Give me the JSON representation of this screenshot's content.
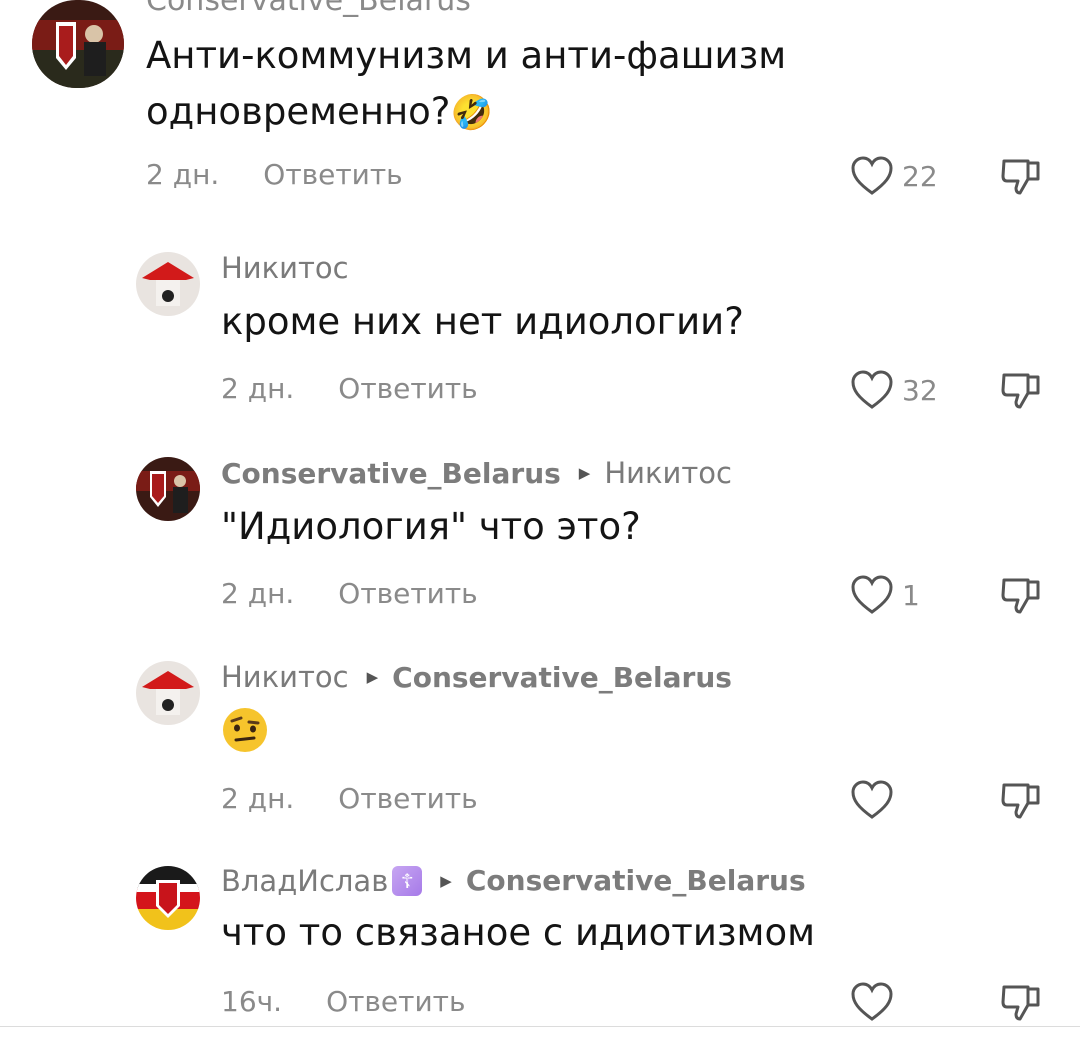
{
  "comments": [
    {
      "author": "Conservative_Belarus",
      "text_line1": "Анти-коммунизм и анти-фашизм",
      "text_line2": "одновременно?",
      "emoji": "🤣",
      "time": "2 дн.",
      "reply_label": "Ответить",
      "likes": "22"
    },
    {
      "author": "Никитос",
      "text": "кроме них нет идиологии?",
      "time": "2 дн.",
      "reply_label": "Ответить",
      "likes": "32"
    },
    {
      "author": "Conservative_Belarus",
      "reply_to": "Никитос",
      "text": "\"Идиология\" что это?",
      "time": "2 дн.",
      "reply_label": "Ответить",
      "likes": "1"
    },
    {
      "author": "Никитос",
      "reply_to": "Conservative_Belarus",
      "emoji": "🤨",
      "time": "2 дн.",
      "reply_label": "Ответить",
      "likes": ""
    },
    {
      "author": "ВладИслав",
      "author_badge": "☦",
      "reply_to": "Conservative_Belarus",
      "text": "что то связаное с идиотизмом",
      "time": "16ч.",
      "reply_label": "Ответить",
      "likes": ""
    }
  ],
  "icons": {
    "like": "heart-outline-icon",
    "dislike": "thumbs-down-icon",
    "reply_arrow": "triangle-right-icon"
  },
  "colors": {
    "text": "#141414",
    "secondary": "#8a8a8a",
    "orth_badge": "#b08be9"
  }
}
